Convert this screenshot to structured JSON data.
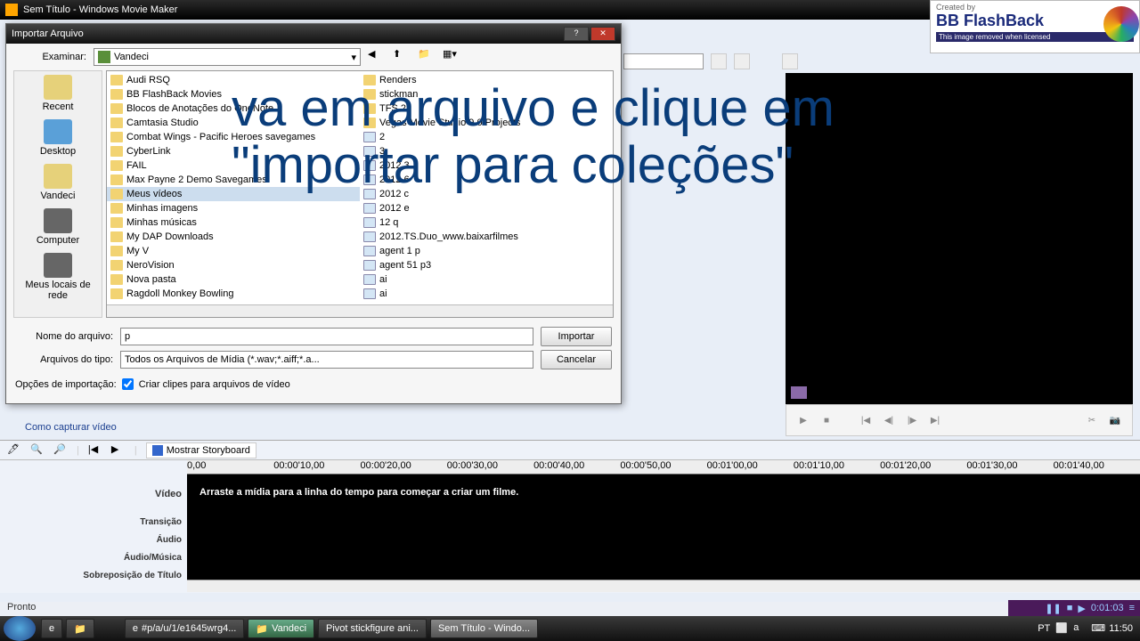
{
  "app": {
    "title": "Sem Título - Windows Movie Maker",
    "task_link": "Como capturar vídeo",
    "status": "Pronto"
  },
  "dialog": {
    "title": "Importar Arquivo",
    "examine_label": "Examinar:",
    "examine_value": "Vandeci",
    "places": {
      "recent": "Recent",
      "desktop": "Desktop",
      "user": "Vandeci",
      "computer": "Computer",
      "network": "Meus locais de rede"
    },
    "files_left": [
      "Audi RSQ",
      "BB FlashBack Movies",
      "Blocos de Anotações do OneNote",
      "Camtasia Studio",
      "Combat Wings - Pacific Heroes savegames",
      "CyberLink",
      "FAIL",
      "Max Payne 2 Demo Savegames",
      "Meus vídeos",
      "Minhas imagens",
      "Minhas músicas",
      "My DAP Downloads",
      "My V",
      "NeroVision",
      "Nova pasta",
      "Ragdoll Monkey Bowling"
    ],
    "files_right": [
      "Renders",
      "stickman",
      "TFS 2",
      "Vegas Movie Studio 9.0 Projects",
      "2",
      "3",
      "2012 3",
      "2012 6",
      "2012 c",
      "2012 e",
      "12 q",
      "2012.TS.Duo_www.baixarfilmes",
      "agent 1 p",
      "agent 51 p3",
      "ai",
      "ai"
    ],
    "filename_label": "Nome do arquivo:",
    "filename_value": "p",
    "filetype_label": "Arquivos do tipo:",
    "filetype_value": "Todos os Arquivos de Mídia (*.wav;*.aiff;*.a...",
    "import_btn": "Importar",
    "cancel_btn": "Cancelar",
    "options_label": "Opções de importação:",
    "checkbox_label": "Criar clipes para arquivos de vídeo"
  },
  "timeline": {
    "storyboard_btn": "Mostrar Storyboard",
    "tracks": {
      "video": "Vídeo",
      "transition": "Transição",
      "audio": "Áudio",
      "audio_music": "Áudio/Música",
      "title_overlay": "Sobreposição de Título"
    },
    "ruler": [
      "0,00",
      "00:00'10,00",
      "00:00'20,00",
      "00:00'30,00",
      "00:00'40,00",
      "00:00'50,00",
      "00:01'00,00",
      "00:01'10,00",
      "00:01'20,00",
      "00:01'30,00",
      "00:01'40,00"
    ],
    "hint": "Arraste a mídia para a linha do tempo para começar a criar um filme."
  },
  "overlay": {
    "text": "va em arquivo e clique em \"importar para coleções\""
  },
  "bb": {
    "created_by": "Created by",
    "product": "BB FlashBack",
    "notice": "This image removed when licensed",
    "rec_time": "0:01:03"
  },
  "taskbar": {
    "items": [
      "#p/a/u/1/e1645wrg4...",
      "Vandeci",
      "Pivot stickfigure ani...",
      "Sem Título - Windo..."
    ],
    "lang": "PT",
    "clock": "11:50"
  }
}
